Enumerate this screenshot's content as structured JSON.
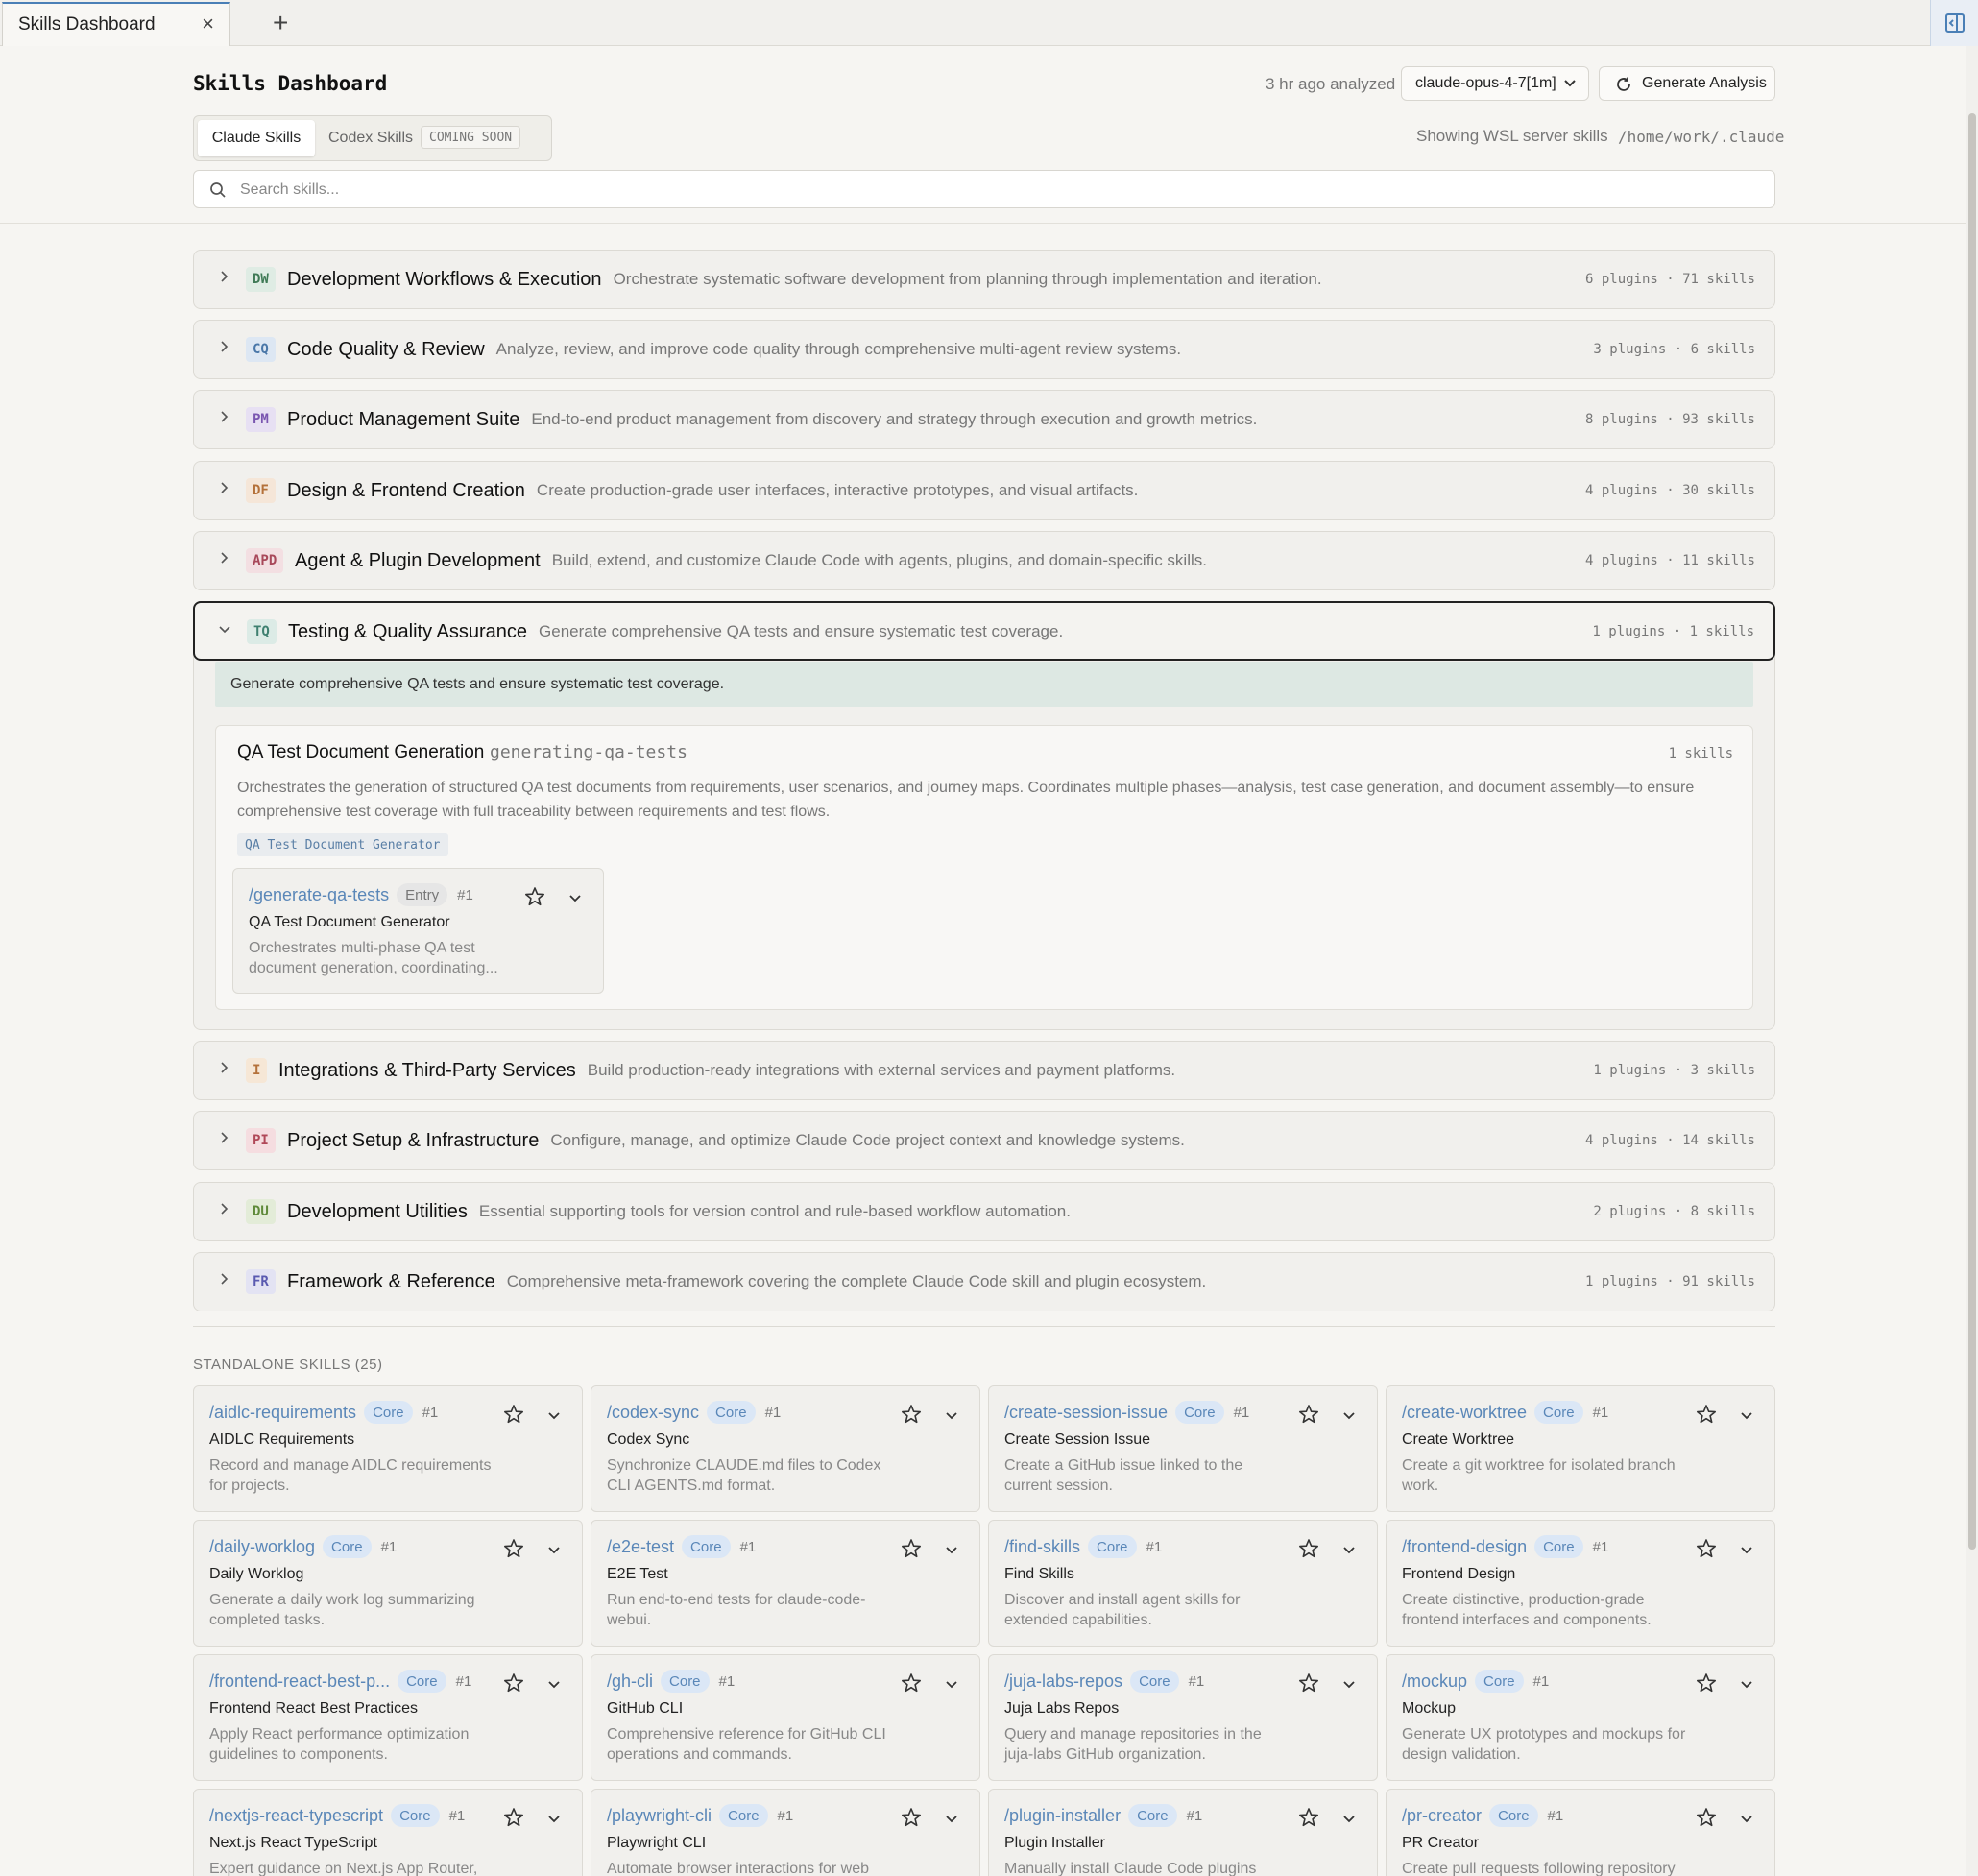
{
  "tab": {
    "title": "Skills Dashboard",
    "close": "×",
    "new": "+"
  },
  "header": {
    "title": "Skills Dashboard",
    "analyzed": "3 hr ago analyzed",
    "model": "claude-opus-4-7[1m]",
    "generate_label": "Generate Analysis",
    "tabs": {
      "claude": "Claude Skills",
      "codex": "Codex Skills",
      "soon": "COMING SOON"
    },
    "showing": "Showing WSL server skills",
    "path": "/home/work/.claude",
    "search_placeholder": "Search skills..."
  },
  "categories": [
    {
      "abbr": "DW",
      "name": "Development Workflows & Execution",
      "desc": "Orchestrate systematic software development from planning through implementation and iteration.",
      "count": "6 plugins · 71 skills",
      "bg": "#dfece4",
      "fg": "#3f7a56"
    },
    {
      "abbr": "CQ",
      "name": "Code Quality & Review",
      "desc": "Analyze, review, and improve code quality through comprehensive multi-agent review systems.",
      "count": "3 plugins · 6 skills",
      "bg": "#dde7f3",
      "fg": "#4a77a8"
    },
    {
      "abbr": "PM",
      "name": "Product Management Suite",
      "desc": "End-to-end product management from discovery and strategy through execution and growth metrics.",
      "count": "8 plugins · 93 skills",
      "bg": "#e7e0f3",
      "fg": "#7a56b0"
    },
    {
      "abbr": "DF",
      "name": "Design & Frontend Creation",
      "desc": "Create production-grade user interfaces, interactive prototypes, and visual artifacts.",
      "count": "4 plugins · 30 skills",
      "bg": "#f5e6d8",
      "fg": "#b4713a"
    },
    {
      "abbr": "APD",
      "name": "Agent & Plugin Development",
      "desc": "Build, extend, and customize Claude Code with agents, plugins, and domain-specific skills.",
      "count": "4 plugins · 11 skills",
      "bg": "#f3dfe2",
      "fg": "#a8485a"
    },
    {
      "abbr": "TQ",
      "name": "Testing & Quality Assurance",
      "desc": "Generate comprehensive QA tests and ensure systematic test coverage.",
      "count": "1 plugins · 1 skills",
      "bg": "#dcebe6",
      "fg": "#3f8070"
    },
    {
      "abbr": "I",
      "name": "Integrations & Third-Party Services",
      "desc": "Build production-ready integrations with external services and payment platforms.",
      "count": "1 plugins · 3 skills",
      "bg": "#f6e7d6",
      "fg": "#b4713a"
    },
    {
      "abbr": "PI",
      "name": "Project Setup & Infrastructure",
      "desc": "Configure, manage, and optimize Claude Code project context and knowledge systems.",
      "count": "4 plugins · 14 skills",
      "bg": "#f5dde0",
      "fg": "#b04858"
    },
    {
      "abbr": "DU",
      "name": "Development Utilities",
      "desc": "Essential supporting tools for version control and rule-based workflow automation.",
      "count": "2 plugins · 8 skills",
      "bg": "#e3ecd8",
      "fg": "#5f8a3a"
    },
    {
      "abbr": "FR",
      "name": "Framework & Reference",
      "desc": "Comprehensive meta-framework covering the complete Claude Code skill and plugin ecosystem.",
      "count": "1 plugins · 91 skills",
      "bg": "#e3e3f3",
      "fg": "#5a5ab0"
    }
  ],
  "expanded": {
    "group_desc": "Generate comprehensive QA tests and ensure systematic test coverage.",
    "plugin": {
      "title": "QA Test Document Generation",
      "id": "generating-qa-tests",
      "count": "1 skills",
      "desc": "Orchestrates the generation of structured QA test documents from requirements, user scenarios, and journey maps. Coordinates multiple phases—analysis, test case generation, and document assembly—to ensure comprehensive test coverage with full traceability between requirements and test flows.",
      "tag": "QA Test Document Generator"
    },
    "skill": {
      "cmd": "/generate-qa-tests",
      "pill": "Entry",
      "rank": "#1",
      "name": "QA Test Document Generator",
      "desc": "Orchestrates multi-phase QA test document generation, coordinating..."
    }
  },
  "standalone": {
    "title": "STANDALONE SKILLS (25)",
    "skills": [
      {
        "cmd": "/aidlc-requirements",
        "pill": "Core",
        "rank": "#1",
        "name": "AIDLC Requirements",
        "desc": "Record and manage AIDLC requirements for projects."
      },
      {
        "cmd": "/codex-sync",
        "pill": "Core",
        "rank": "#1",
        "name": "Codex Sync",
        "desc": "Synchronize CLAUDE.md files to Codex CLI AGENTS.md format."
      },
      {
        "cmd": "/create-session-issue",
        "pill": "Core",
        "rank": "#1",
        "name": "Create Session Issue",
        "desc": "Create a GitHub issue linked to the current session."
      },
      {
        "cmd": "/create-worktree",
        "pill": "Core",
        "rank": "#1",
        "name": "Create Worktree",
        "desc": "Create a git worktree for isolated branch work."
      },
      {
        "cmd": "/daily-worklog",
        "pill": "Core",
        "rank": "#1",
        "name": "Daily Worklog",
        "desc": "Generate a daily work log summarizing completed tasks."
      },
      {
        "cmd": "/e2e-test",
        "pill": "Core",
        "rank": "#1",
        "name": "E2E Test",
        "desc": "Run end-to-end tests for claude-code-webui."
      },
      {
        "cmd": "/find-skills",
        "pill": "Core",
        "rank": "#1",
        "name": "Find Skills",
        "desc": "Discover and install agent skills for extended capabilities."
      },
      {
        "cmd": "/frontend-design",
        "pill": "Core",
        "rank": "#1",
        "name": "Frontend Design",
        "desc": "Create distinctive, production-grade frontend interfaces and components."
      },
      {
        "cmd": "/frontend-react-best-p...",
        "pill": "Core",
        "rank": "#1",
        "name": "Frontend React Best Practices",
        "desc": "Apply React performance optimization guidelines to components."
      },
      {
        "cmd": "/gh-cli",
        "pill": "Core",
        "rank": "#1",
        "name": "GitHub CLI",
        "desc": "Comprehensive reference for GitHub CLI operations and commands."
      },
      {
        "cmd": "/juja-labs-repos",
        "pill": "Core",
        "rank": "#1",
        "name": "Juja Labs Repos",
        "desc": "Query and manage repositories in the juja-labs GitHub organization."
      },
      {
        "cmd": "/mockup",
        "pill": "Core",
        "rank": "#1",
        "name": "Mockup",
        "desc": "Generate UX prototypes and mockups for design validation."
      },
      {
        "cmd": "/nextjs-react-typescript",
        "pill": "Core",
        "rank": "#1",
        "name": "Next.js React TypeScript",
        "desc": "Expert guidance on Next.js App Router,"
      },
      {
        "cmd": "/playwright-cli",
        "pill": "Core",
        "rank": "#1",
        "name": "Playwright CLI",
        "desc": "Automate browser interactions for web"
      },
      {
        "cmd": "/plugin-installer",
        "pill": "Core",
        "rank": "#1",
        "name": "Plugin Installer",
        "desc": "Manually install Claude Code plugins"
      },
      {
        "cmd": "/pr-creator",
        "pill": "Core",
        "rank": "#1",
        "name": "PR Creator",
        "desc": "Create pull requests following repository"
      }
    ]
  }
}
